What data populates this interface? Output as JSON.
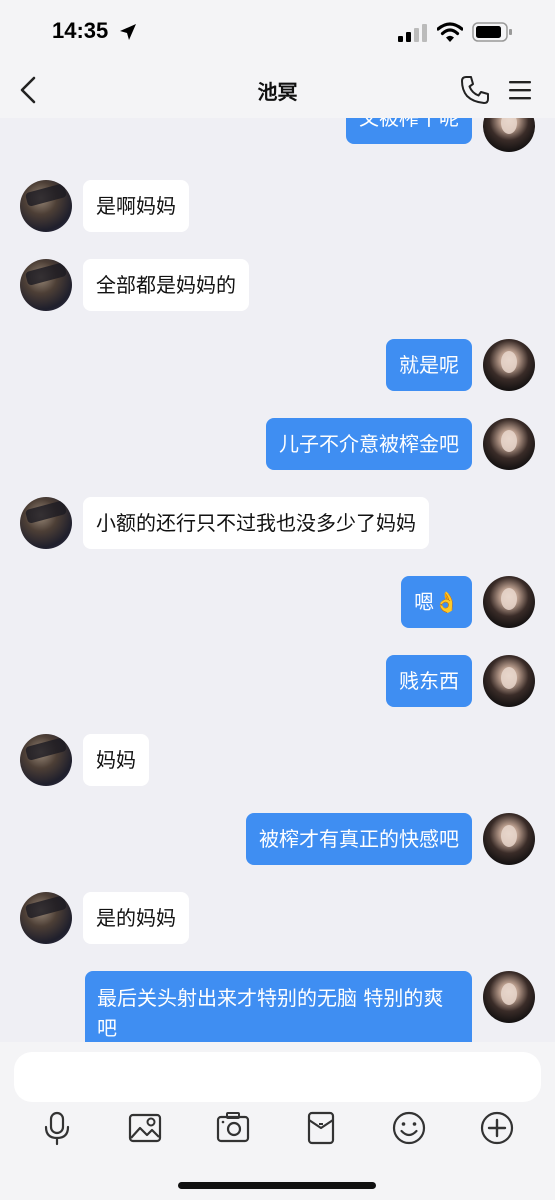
{
  "status_bar": {
    "time": "14:35"
  },
  "header": {
    "title": "池冥"
  },
  "messages": [
    {
      "side": "right",
      "text": "又被榨干呢"
    },
    {
      "side": "left",
      "text": "是啊妈妈"
    },
    {
      "side": "left",
      "text": "全部都是妈妈的"
    },
    {
      "side": "right",
      "text": "就是呢"
    },
    {
      "side": "right",
      "text": "儿子不介意被榨金吧"
    },
    {
      "side": "left",
      "text": "小额的还行只不过我也没多少了妈妈"
    },
    {
      "side": "right",
      "text": "嗯👌"
    },
    {
      "side": "right",
      "text": "贱东西"
    },
    {
      "side": "left",
      "text": "妈妈"
    },
    {
      "side": "right",
      "text": "被榨才有真正的快感吧"
    },
    {
      "side": "left",
      "text": "是的妈妈"
    },
    {
      "side": "right",
      "text": "最后关头射出来才特别的无脑 特别的爽吧"
    }
  ],
  "input": {
    "placeholder": ""
  },
  "toolbar": {
    "icons": [
      "microphone-icon",
      "image-icon",
      "camera-icon",
      "red-packet-icon",
      "emoji-icon",
      "plus-icon"
    ]
  },
  "colors": {
    "outgoing_bubble": "#3f8ef2",
    "incoming_bubble": "#ffffff",
    "background": "#efeff4"
  }
}
